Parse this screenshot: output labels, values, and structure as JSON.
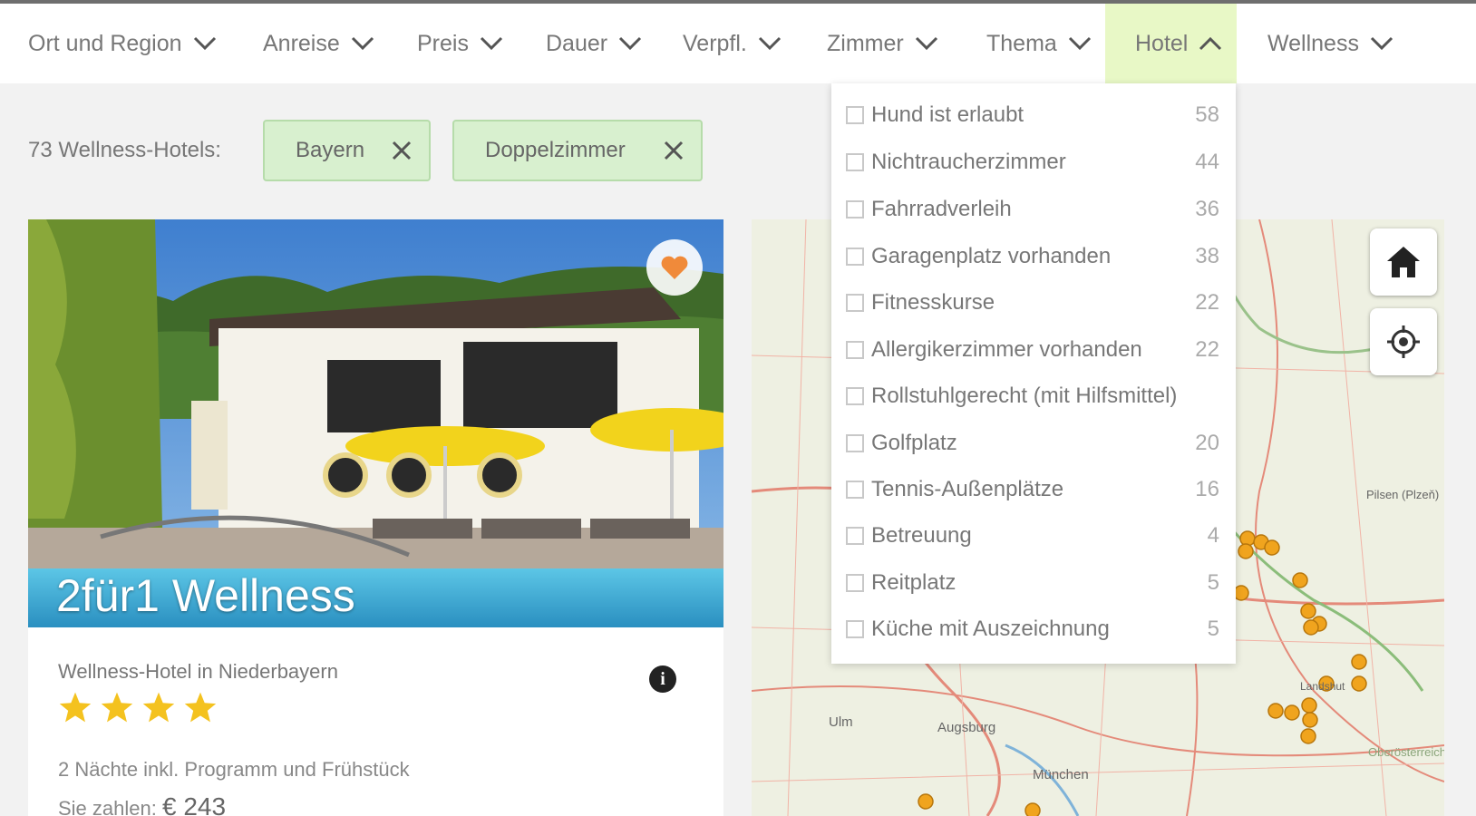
{
  "filters": {
    "items": [
      {
        "label": "Ort und Region"
      },
      {
        "label": "Anreise"
      },
      {
        "label": "Preis"
      },
      {
        "label": "Dauer"
      },
      {
        "label": "Verpfl."
      },
      {
        "label": "Zimmer"
      },
      {
        "label": "Thema"
      },
      {
        "label": "Hotel",
        "expanded": true
      },
      {
        "label": "Wellness"
      }
    ],
    "active_color": "#e8f8c6"
  },
  "results": {
    "count_label": "73 Wellness-Hotels:",
    "chips": [
      {
        "label": "Bayern"
      },
      {
        "label": "Doppelzimmer"
      }
    ]
  },
  "hotel_dropdown": {
    "options": [
      {
        "label": "Hund ist erlaubt",
        "count": "58"
      },
      {
        "label": "Nichtraucherzimmer",
        "count": "44"
      },
      {
        "label": "Fahrradverleih",
        "count": "36"
      },
      {
        "label": "Garagenplatz vorhanden",
        "count": "38"
      },
      {
        "label": "Fitnesskurse",
        "count": "22"
      },
      {
        "label": "Allergikerzimmer vorhanden",
        "count": "22"
      },
      {
        "label": "Rollstuhlgerecht (mit Hilfsmittel)",
        "count": ""
      },
      {
        "label": "Golfplatz",
        "count": "20"
      },
      {
        "label": "Tennis-Außenplätze",
        "count": "16"
      },
      {
        "label": "Betreuung",
        "count": "4"
      },
      {
        "label": "Reitplatz",
        "count": "5"
      },
      {
        "label": "Küche mit Auszeichnung",
        "count": "5"
      }
    ]
  },
  "card": {
    "image_title": "2für1 Wellness",
    "subtitle": "Wellness-Hotel in Niederbayern",
    "stars": 4,
    "description": "2 Nächte inkl. Programm und Frühstück",
    "price_label": "Sie zahlen:",
    "price": "€ 243",
    "favorite_color": "#f08a3a",
    "info_icon": "info-icon"
  },
  "map": {
    "labels": [
      "Augsburg",
      "München",
      "Ulm",
      "Pilsen (Plzeň)",
      "Landshut",
      "Oberösterreich"
    ],
    "home_icon": "home-icon",
    "locate_icon": "locate-icon"
  }
}
